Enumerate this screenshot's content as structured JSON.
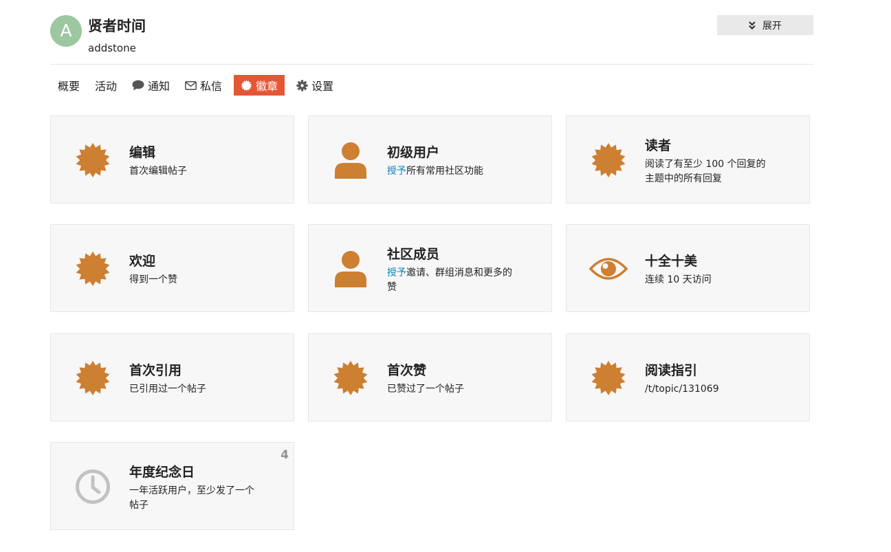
{
  "user": {
    "avatar_letter": "A",
    "name": "贤者时间",
    "handle": "addstone"
  },
  "expand_label": "展开",
  "nav": {
    "summary": "概要",
    "activity": "活动",
    "notifications": "通知",
    "messages": "私信",
    "badges": "徽章",
    "preferences": "设置"
  },
  "colors": {
    "accent": "#e45735",
    "badge_bronze": "#cd7f32",
    "card_bg": "#f7f7f7",
    "link": "#0a83b8"
  },
  "badges": [
    {
      "title": "编辑",
      "desc": "首次编辑帖子",
      "icon": "certificate-icon"
    },
    {
      "title": "初级用户",
      "desc_link": "授予",
      "desc_rest": "所有常用社区功能",
      "icon": "user-icon"
    },
    {
      "title": "读者",
      "desc": "阅读了有至少 100 个回复的主题中的所有回复",
      "icon": "certificate-icon"
    },
    {
      "title": "欢迎",
      "desc": "得到一个赞",
      "icon": "certificate-icon"
    },
    {
      "title": "社区成员",
      "desc_link": "授予",
      "desc_rest": "邀请、群组消息和更多的赞",
      "icon": "user-icon"
    },
    {
      "title": "十全十美",
      "desc": "连续 10 天访问",
      "icon": "eye-icon"
    },
    {
      "title": "首次引用",
      "desc": "已引用过一个帖子",
      "icon": "certificate-icon"
    },
    {
      "title": "首次赞",
      "desc": "已赞过了一个帖子",
      "icon": "certificate-icon"
    },
    {
      "title": "阅读指引",
      "desc": "/t/topic/131069",
      "icon": "certificate-icon"
    },
    {
      "title": "年度纪念日",
      "desc": "一年活跃用户，至少发了一个帖子",
      "icon": "clock-icon",
      "count": "4"
    }
  ]
}
